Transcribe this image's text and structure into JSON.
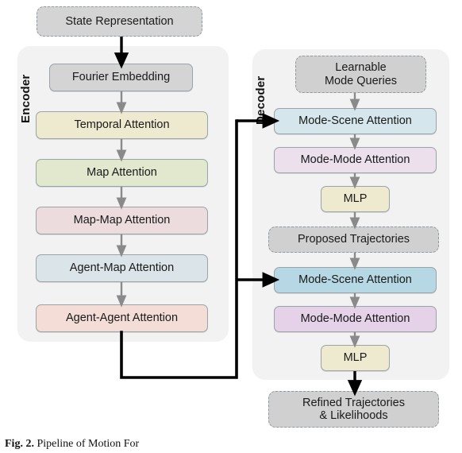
{
  "diagram": {
    "encoder": {
      "label": "Encoder",
      "nodes": [
        {
          "text": "Fourier Embedding",
          "color": "#d4d4d4",
          "style": "solid"
        },
        {
          "text": "Temporal Attention",
          "color": "#eeead0",
          "style": "solid"
        },
        {
          "text": "Map Attention",
          "color": "#e2e8cd",
          "style": "solid"
        },
        {
          "text": "Map-Map Attention",
          "color": "#ecdcdd",
          "style": "solid"
        },
        {
          "text": "Agent-Map Attention",
          "color": "#dbe4e8",
          "style": "solid"
        },
        {
          "text": "Agent-Agent Attention",
          "color": "#f4ddd6",
          "style": "solid"
        }
      ]
    },
    "decoder": {
      "label": "Decoder",
      "nodes": [
        {
          "text": "Learnable\nMode Queries",
          "color": "#d0d0d0",
          "style": "dashed"
        },
        {
          "text": "Mode-Scene Attention",
          "color": "#d6e6ed",
          "style": "solid"
        },
        {
          "text": "Mode-Mode Attention",
          "color": "#ece0ec",
          "style": "solid"
        },
        {
          "text": "MLP",
          "color": "#eeead0",
          "style": "solid"
        },
        {
          "text": "Proposed Trajectories",
          "color": "#d0d0d0",
          "style": "dashed"
        },
        {
          "text": "Mode-Scene Attention",
          "color": "#b6d8e4",
          "style": "solid"
        },
        {
          "text": "Mode-Mode Attention",
          "color": "#e5d1e8",
          "style": "solid"
        },
        {
          "text": "MLP",
          "color": "#eeead0",
          "style": "solid"
        }
      ]
    },
    "input": {
      "text": "State Representation",
      "color": "#d4d4d4",
      "style": "dashed"
    },
    "output": {
      "line1": "Refined Trajectories",
      "line2": "& Likelihoods",
      "color": "#d0d0d0",
      "style": "dashed"
    },
    "labels": {
      "input": "State Representation",
      "fourier": "Fourier Embedding",
      "temporal": "Temporal Attention",
      "map": "Map Attention",
      "mapmap": "Map-Map Attention",
      "agentmap": "Agent-Map Attention",
      "agentagent": "Agent-Agent Attention",
      "queries_l1": "Learnable",
      "queries_l2": "Mode Queries",
      "modescene1": "Mode-Scene Attention",
      "modemode1": "Mode-Mode Attention",
      "mlp1": "MLP",
      "proposed": "Proposed Trajectories",
      "modescene2": "Mode-Scene Attention",
      "modemode2": "Mode-Mode Attention",
      "mlp2": "MLP",
      "refined_l1": "Refined Trajectories",
      "refined_l2": "& Likelihoods"
    },
    "colors": {
      "panel": "#f2f2f2",
      "connector": "#8a8a8a",
      "main_flow": "#000000",
      "border": "#9aa3a8"
    }
  },
  "caption": {
    "fig": "Fig. 2.",
    "text": "Pipeline of Motion For"
  }
}
